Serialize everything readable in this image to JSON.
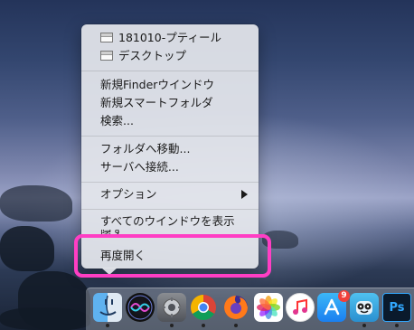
{
  "context_menu": {
    "recent_items": [
      {
        "label": "181010-プティール",
        "icon": "window-icon"
      },
      {
        "label": "デスクトップ",
        "icon": "window-icon"
      }
    ],
    "new_finder_window": "新規Finderウインドウ",
    "new_smart_folder": "新規スマートフォルダ",
    "find": "検索...",
    "go_to_folder": "フォルダへ移動...",
    "connect_to_server": "サーバへ接続...",
    "options": "オプション",
    "show_all_windows": "すべてのウインドウを表示",
    "hide": "隠す",
    "reopen": "再度開く"
  },
  "highlight_color": "#ff3ec4",
  "dock": {
    "icons": [
      {
        "name": "finder-icon",
        "running": true
      },
      {
        "name": "siri-icon",
        "running": false
      },
      {
        "name": "system-preferences-icon",
        "running": true
      },
      {
        "name": "chrome-icon",
        "running": true
      },
      {
        "name": "firefox-icon",
        "running": true
      },
      {
        "name": "photos-icon",
        "running": false
      },
      {
        "name": "itunes-icon",
        "running": false
      },
      {
        "name": "app-store-icon",
        "running": false,
        "badge": "9"
      },
      {
        "name": "tweetbot-icon",
        "running": true
      },
      {
        "name": "photoshop-icon",
        "running": true,
        "label": "Ps"
      }
    ]
  }
}
